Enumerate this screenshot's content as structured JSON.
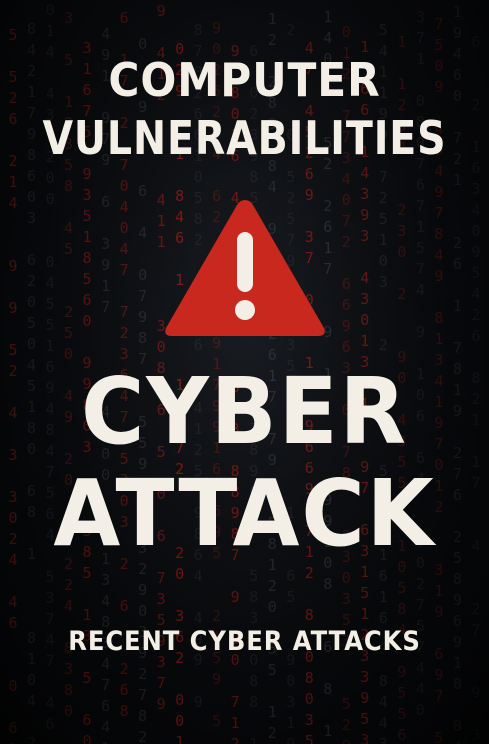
{
  "cover": {
    "title_line1": "COMPUTER",
    "title_line2": "VULNERABILITIES",
    "headline_line1": "CYBER",
    "headline_line2": "ATTACK",
    "subtitle": "RECENT CYBER ATTACKS",
    "warning_icon": "warning-triangle-exclamation",
    "colors": {
      "background": "#0b0d10",
      "text": "#f3efe6",
      "warning": "#c8281e",
      "code_red": "#b3231c",
      "code_dim": "#3a3e46"
    }
  }
}
